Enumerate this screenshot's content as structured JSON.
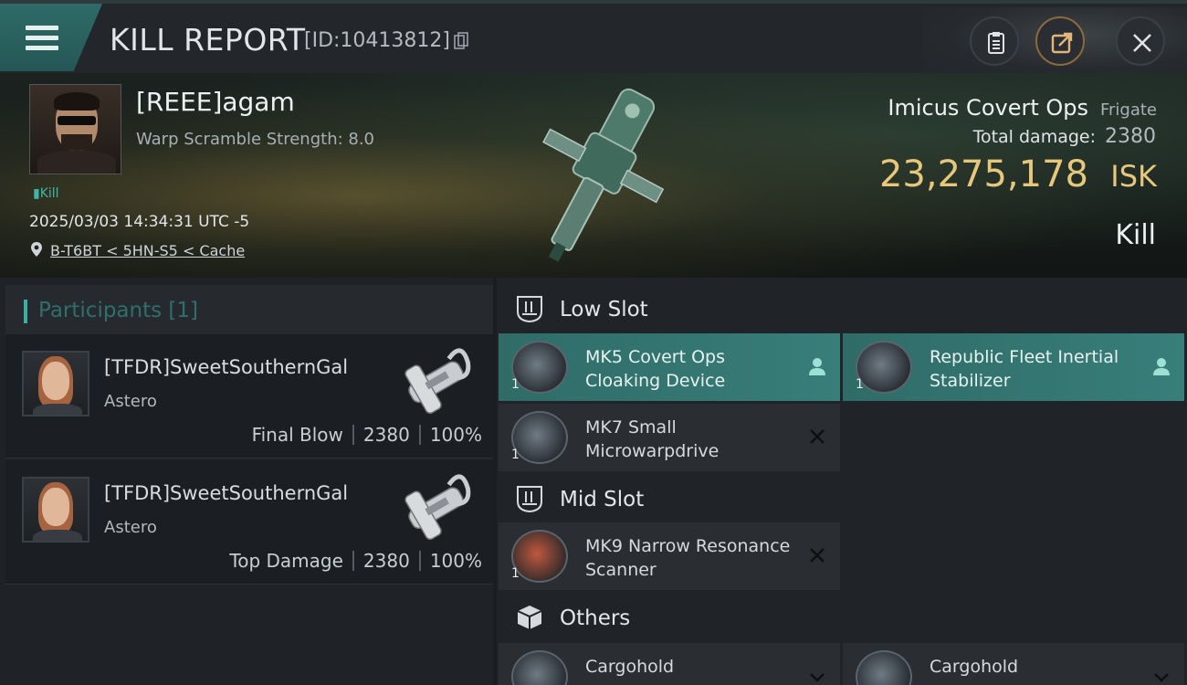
{
  "header": {
    "title": "KILL REPORT",
    "report_id": "[ID:10413812]"
  },
  "victim": {
    "name": "[REEE]agam",
    "subtitle": "Warp Scramble Strength: 8.0",
    "tag": "Kill",
    "datetime": "2025/03/03 14:34:31 UTC -5",
    "location": "B-T6BT < 5HN-S5 < Cache",
    "ship_name": "Imicus Covert Ops",
    "ship_class": "Frigate",
    "total_damage_label": "Total damage:",
    "total_damage": "2380",
    "isk_value": "23,275,178",
    "isk_unit": "ISK",
    "outcome": "Kill"
  },
  "participants": {
    "title": "Participants",
    "count": "[1]",
    "rows": [
      {
        "name": "[TFDR]SweetSouthernGal",
        "ship": "Astero",
        "role": "Final Blow",
        "damage": "2380",
        "percent": "100%"
      },
      {
        "name": "[TFDR]SweetSouthernGal",
        "ship": "Astero",
        "role": "Top Damage",
        "damage": "2380",
        "percent": "100%"
      }
    ]
  },
  "fitting": {
    "low_slot": {
      "title": "Low Slot",
      "modules": [
        {
          "name": "MK5 Covert Ops Cloaking Device",
          "qty": "1",
          "state": "fitted"
        },
        {
          "name": "Republic Fleet Inertial Stabilizer",
          "qty": "1",
          "state": "fitted"
        },
        {
          "name": "MK7 Small Microwarpdrive",
          "qty": "1",
          "state": "destroyed"
        }
      ]
    },
    "mid_slot": {
      "title": "Mid Slot",
      "modules": [
        {
          "name": "MK9 Narrow Resonance Scanner",
          "qty": "1",
          "state": "destroyed"
        }
      ]
    },
    "others": {
      "title": "Others",
      "modules": [
        {
          "name": "Cargohold",
          "qty": "",
          "state": "collapsed"
        },
        {
          "name": "Cargohold",
          "qty": "",
          "state": "collapsed"
        }
      ]
    }
  },
  "colors": {
    "accent": "#3ab0a3",
    "isk": "#e7c77b",
    "fitted_bg": "#387e79"
  }
}
